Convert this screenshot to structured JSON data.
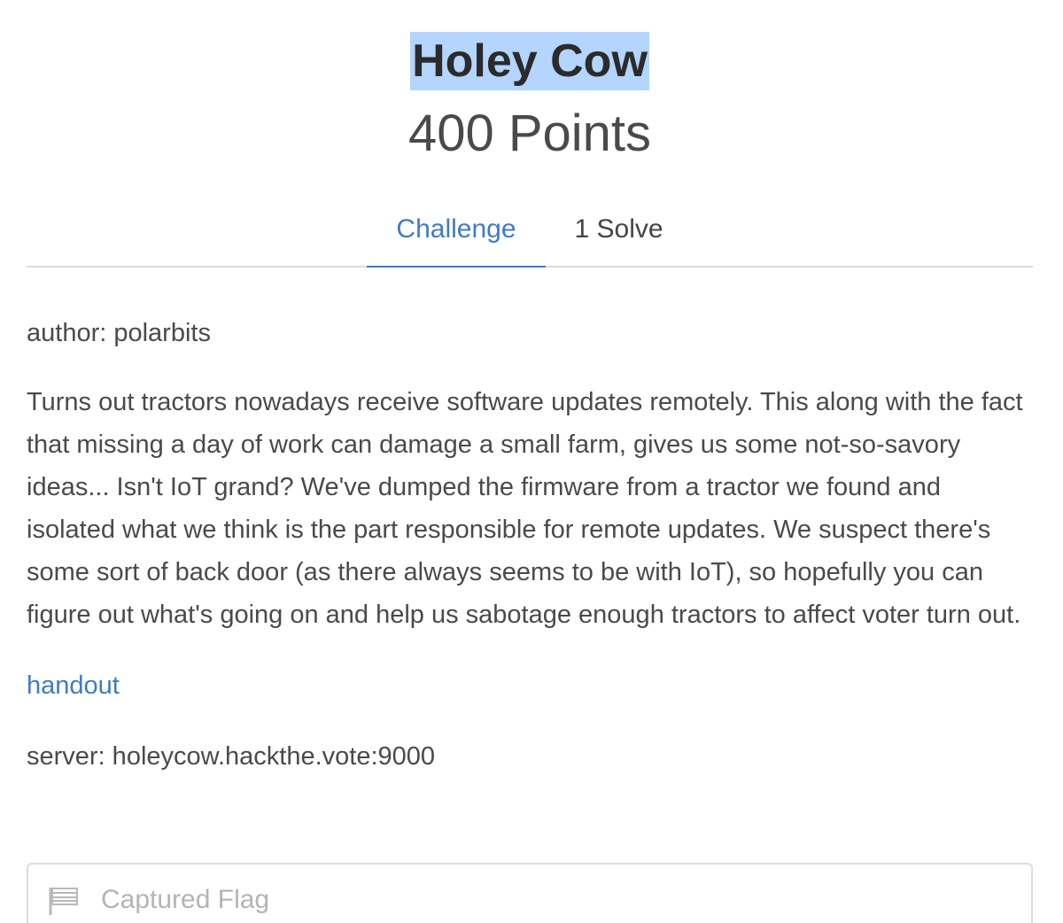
{
  "challenge": {
    "title": "Holey Cow",
    "points": "400 Points"
  },
  "tabs": [
    {
      "label": "Challenge",
      "active": true
    },
    {
      "label": "1 Solve",
      "active": false
    }
  ],
  "content": {
    "author": "author: polarbits",
    "description": "Turns out tractors nowadays receive software updates remotely. This along with the fact that missing a day of work can damage a small farm, gives us some not-so-savory ideas... Isn't IoT grand? We've dumped the firmware from a tractor we found and isolated what we think is the part responsible for remote updates. We suspect there's some sort of back door (as there always seems to be with IoT), so hopefully you can figure out what's going on and help us sabotage enough tractors to affect voter turn out.",
    "handout_link": "handout",
    "server": "server: holeycow.hackthe.vote:9000"
  },
  "flag_input": {
    "placeholder": "Captured Flag",
    "value": "",
    "icon": "flag-icon"
  },
  "colors": {
    "accent": "#3f7bc7",
    "selection": "#b4d5fe",
    "text": "#4a4a4a",
    "border": "#dcdcdc"
  }
}
